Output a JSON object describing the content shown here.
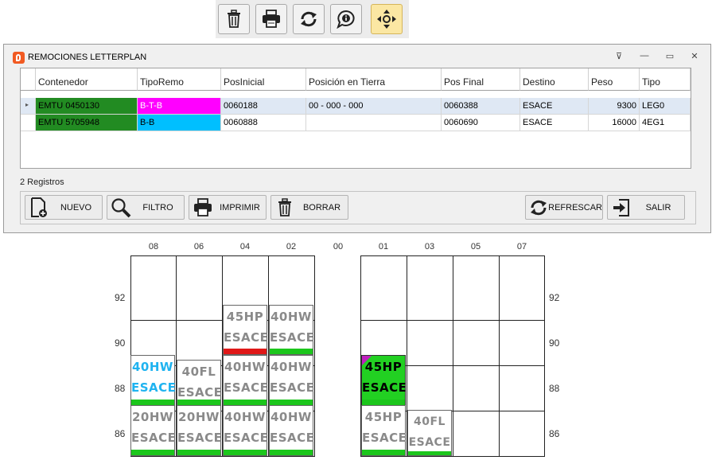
{
  "toolbar": {
    "buttons": [
      {
        "icon": "trash-icon",
        "active": false
      },
      {
        "icon": "print-icon",
        "active": false
      },
      {
        "icon": "refresh-icon",
        "active": false
      },
      {
        "icon": "info-chat-icon",
        "active": false
      },
      {
        "icon": "move-icon",
        "active": true
      }
    ]
  },
  "window": {
    "title": "REMOCIONES LETTERPLAN",
    "controls": [
      "⊽",
      "—",
      "▭",
      "✕"
    ]
  },
  "grid": {
    "columns": [
      "Contenedor",
      "TipoRemo",
      "PosInicial",
      "Posición en Tierra",
      "Pos Final",
      "Destino",
      "Peso",
      "Tipo"
    ],
    "rows": [
      {
        "marker": "▸",
        "cells": [
          "EMTU 0450130",
          "B-T-B",
          "0060188",
          "00 - 000 - 000",
          "0060388",
          "ESACE",
          "9300",
          "LEG0"
        ]
      },
      {
        "marker": "",
        "cells": [
          "EMTU 5705948",
          "B-B",
          "0060888",
          "",
          "0060690",
          "ESACE",
          "16000",
          "4EG1"
        ]
      }
    ]
  },
  "records": "2 Registros",
  "actions": {
    "nuevo": "NUEVO",
    "filtro": "FILTRO",
    "imprimir": "IMPRIMIR",
    "borrar": "BORRAR",
    "refrescar": "REFRESCAR",
    "salir": "SALIR"
  },
  "yard": {
    "left_columns": [
      "08",
      "06",
      "04",
      "02"
    ],
    "center_column": "00",
    "right_columns": [
      "01",
      "03",
      "05",
      "07"
    ],
    "rows": [
      "92",
      "90",
      "88",
      "86"
    ],
    "containers": [
      {
        "l1": "40HW",
        "l2": "ESACE",
        "bar": "green",
        "color": "#1fb3f0"
      },
      {
        "l1": "40FL",
        "l2": "ESACE",
        "bar": "green"
      },
      {
        "l1": "45HP",
        "l2": "ESACE",
        "bar": "red"
      },
      {
        "l1": "40HW",
        "l2": "ESACE",
        "bar": "green"
      },
      {
        "l1": "40HW",
        "l2": "ESACE",
        "bar": "green"
      },
      {
        "l1": "40HW",
        "l2": "ESACE",
        "bar": "green"
      },
      {
        "l1": "20HW",
        "l2": "ESACE",
        "bar": "green"
      },
      {
        "l1": "20HW",
        "l2": "ESACE",
        "bar": "green"
      },
      {
        "l1": "40HW",
        "l2": "ESACE",
        "bar": "green"
      },
      {
        "l1": "40HW",
        "l2": "ESACE",
        "bar": "green"
      },
      {
        "l1": "45HP",
        "l2": "ESACE",
        "bar": "green",
        "selected": true
      },
      {
        "l1": "45HP",
        "l2": "ESACE",
        "bar": "green"
      },
      {
        "l1": "40FL",
        "l2": "ESACE",
        "bar": "green"
      }
    ]
  },
  "colors": {
    "contenedor_bg": "#228b22",
    "b_t_b": "#ff00ff",
    "b_b": "#00bfff",
    "selected_container": "#22d022",
    "ok_bar": "#1cc61c",
    "alert_bar": "#e01818",
    "active_tool": "#fbe7a3"
  }
}
